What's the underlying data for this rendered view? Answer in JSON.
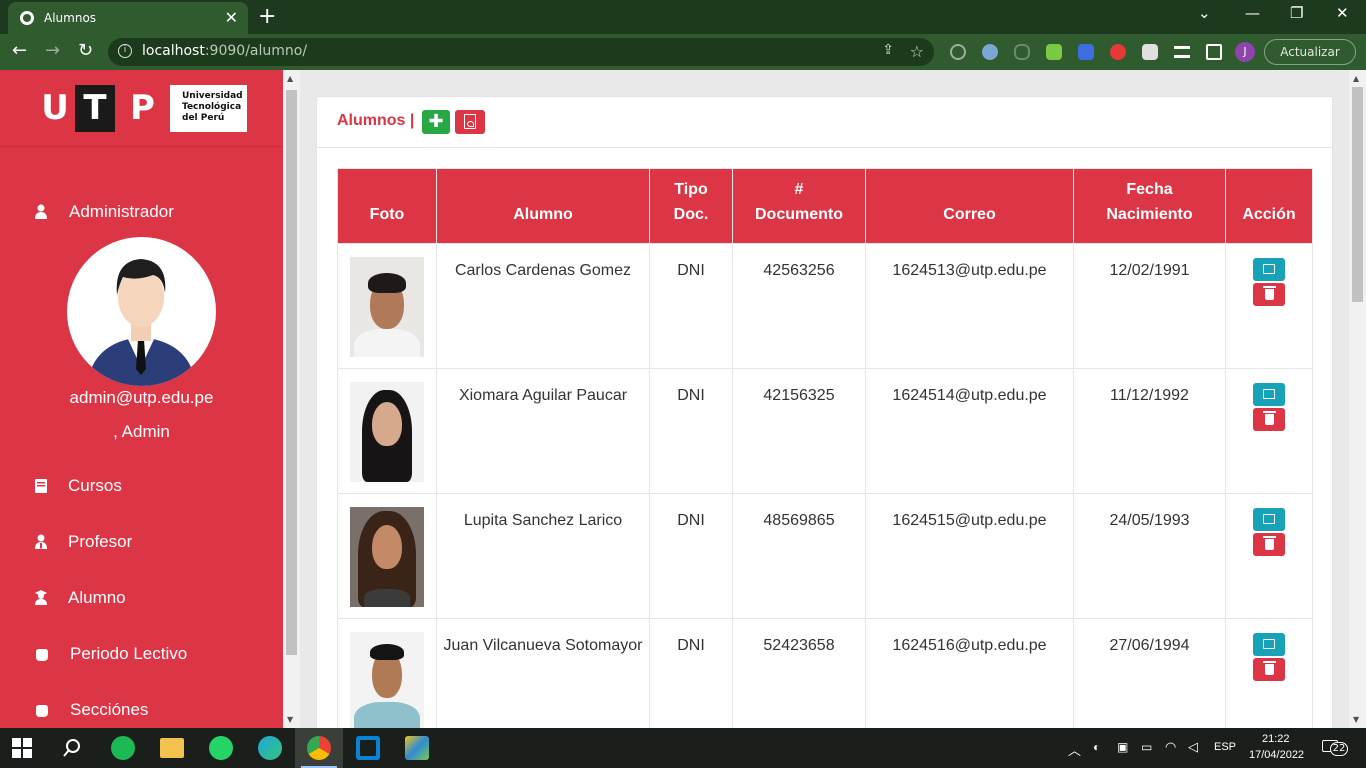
{
  "browser": {
    "tab_title": "Alumnos",
    "tab_close": "✕",
    "new_tab": "+",
    "url_host": "localhost",
    "url_rest": ":9090/alumno/",
    "update_label": "Actualizar",
    "profile_initial": "J",
    "window_controls": [
      "⌄",
      "—",
      "❐",
      "✕"
    ]
  },
  "sidebar": {
    "logo": {
      "letters": [
        "U",
        "T",
        "P"
      ],
      "lines": [
        "Universidad",
        "Tecnológica",
        "del Perú"
      ]
    },
    "admin_label": "Administrador",
    "user_email": "admin@utp.edu.pe",
    "user_role": ", Admin",
    "items": [
      {
        "label": "Cursos",
        "icon": "book-icon"
      },
      {
        "label": "Profesor",
        "icon": "user-tie-icon"
      },
      {
        "label": "Alumno",
        "icon": "user-graduate-icon"
      },
      {
        "label": "Periodo Lectivo",
        "icon": "hand-icon"
      },
      {
        "label": "Secciónes",
        "icon": "hand-icon"
      }
    ]
  },
  "main": {
    "title": "Alumnos |",
    "add_button_symbol": "✚",
    "table": {
      "headers": [
        [
          "Foto"
        ],
        [
          "Alumno"
        ],
        [
          "Tipo",
          "Doc."
        ],
        [
          "#",
          "Documento"
        ],
        [
          "Correo"
        ],
        [
          "Fecha",
          "Nacimiento"
        ],
        [
          "Acción"
        ]
      ],
      "rows": [
        {
          "nombre": "Carlos Cardenas Gomez",
          "tipo": "DNI",
          "documento": "42563256",
          "correo": "1624513@utp.edu.pe",
          "fecha": "12/02/1991"
        },
        {
          "nombre": "Xiomara Aguilar Paucar",
          "tipo": "DNI",
          "documento": "42156325",
          "correo": "1624514@utp.edu.pe",
          "fecha": "11/12/1992"
        },
        {
          "nombre": "Lupita Sanchez Larico",
          "tipo": "DNI",
          "documento": "48569865",
          "correo": "1624515@utp.edu.pe",
          "fecha": "24/05/1993"
        },
        {
          "nombre": "Juan Vilcanueva Sotomayor",
          "tipo": "DNI",
          "documento": "52423658",
          "correo": "1624516@utp.edu.pe",
          "fecha": "27/06/1994"
        }
      ]
    }
  },
  "taskbar": {
    "lang": "ESP",
    "time": "21:22",
    "date": "17/04/2022",
    "notifications": "22"
  },
  "colors": {
    "accent": "#dc3545",
    "success": "#28a745",
    "info": "#17a2b8",
    "chrome": "#2f5b2f"
  }
}
